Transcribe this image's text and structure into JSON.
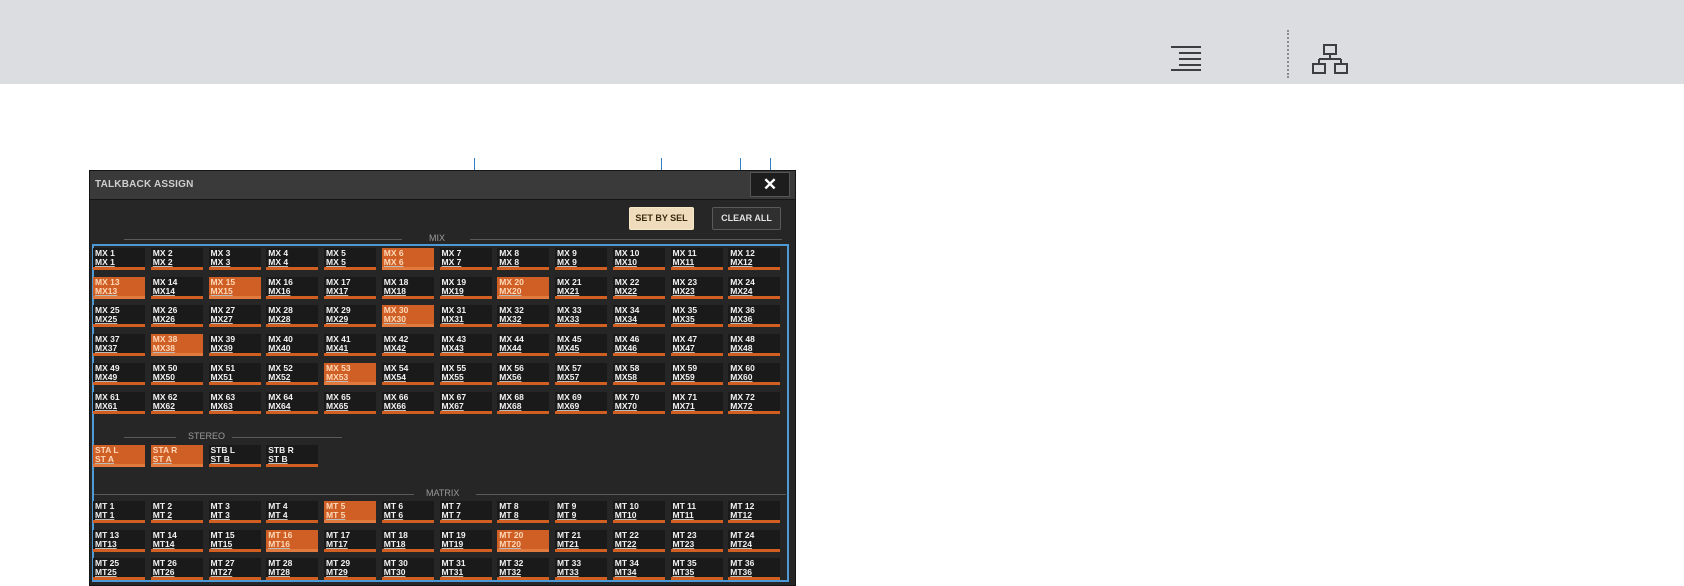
{
  "panel": {
    "title": "TALKBACK ASSIGN",
    "close_glyph": "✕",
    "buttons": {
      "set_by_sel": "SET BY SEL",
      "clear_all": "CLEAR ALL"
    }
  },
  "toolbar": {
    "icons": [
      "outline-menu-icon",
      "hierarchy-tree-icon"
    ]
  },
  "colors": {
    "active": "#cf5f25",
    "indicator": "#d25f22",
    "callout": "#2f7fc6",
    "panel": "#262626",
    "button_highlight": "#efdcbc"
  },
  "sections": {
    "mix": {
      "label": "MIX",
      "rows": [
        [
          {
            "a": "MX 1",
            "b": "MX 1",
            "on": false
          },
          {
            "a": "MX 2",
            "b": "MX 2",
            "on": false
          },
          {
            "a": "MX 3",
            "b": "MX 3",
            "on": false
          },
          {
            "a": "MX 4",
            "b": "MX 4",
            "on": false
          },
          {
            "a": "MX 5",
            "b": "MX 5",
            "on": false
          },
          {
            "a": "MX 6",
            "b": "MX 6",
            "on": true
          },
          {
            "a": "MX 7",
            "b": "MX 7",
            "on": false
          },
          {
            "a": "MX 8",
            "b": "MX 8",
            "on": false
          },
          {
            "a": "MX 9",
            "b": "MX 9",
            "on": false
          },
          {
            "a": "MX 10",
            "b": "MX10",
            "on": false
          },
          {
            "a": "MX 11",
            "b": "MX11",
            "on": false
          },
          {
            "a": "MX 12",
            "b": "MX12",
            "on": false
          }
        ],
        [
          {
            "a": "MX 13",
            "b": "MX13",
            "on": true
          },
          {
            "a": "MX 14",
            "b": "MX14",
            "on": false
          },
          {
            "a": "MX 15",
            "b": "MX15",
            "on": true
          },
          {
            "a": "MX 16",
            "b": "MX16",
            "on": false
          },
          {
            "a": "MX 17",
            "b": "MX17",
            "on": false
          },
          {
            "a": "MX 18",
            "b": "MX18",
            "on": false
          },
          {
            "a": "MX 19",
            "b": "MX19",
            "on": false
          },
          {
            "a": "MX 20",
            "b": "MX20",
            "on": true
          },
          {
            "a": "MX 21",
            "b": "MX21",
            "on": false
          },
          {
            "a": "MX 22",
            "b": "MX22",
            "on": false
          },
          {
            "a": "MX 23",
            "b": "MX23",
            "on": false
          },
          {
            "a": "MX 24",
            "b": "MX24",
            "on": false
          }
        ],
        [
          {
            "a": "MX 25",
            "b": "MX25",
            "on": false
          },
          {
            "a": "MX 26",
            "b": "MX26",
            "on": false
          },
          {
            "a": "MX 27",
            "b": "MX27",
            "on": false
          },
          {
            "a": "MX 28",
            "b": "MX28",
            "on": false
          },
          {
            "a": "MX 29",
            "b": "MX29",
            "on": false
          },
          {
            "a": "MX 30",
            "b": "MX30",
            "on": true
          },
          {
            "a": "MX 31",
            "b": "MX31",
            "on": false
          },
          {
            "a": "MX 32",
            "b": "MX32",
            "on": false
          },
          {
            "a": "MX 33",
            "b": "MX33",
            "on": false
          },
          {
            "a": "MX 34",
            "b": "MX34",
            "on": false
          },
          {
            "a": "MX 35",
            "b": "MX35",
            "on": false
          },
          {
            "a": "MX 36",
            "b": "MX36",
            "on": false
          }
        ],
        [
          {
            "a": "MX 37",
            "b": "MX37",
            "on": false
          },
          {
            "a": "MX 38",
            "b": "MX38",
            "on": true
          },
          {
            "a": "MX 39",
            "b": "MX39",
            "on": false
          },
          {
            "a": "MX 40",
            "b": "MX40",
            "on": false
          },
          {
            "a": "MX 41",
            "b": "MX41",
            "on": false
          },
          {
            "a": "MX 42",
            "b": "MX42",
            "on": false
          },
          {
            "a": "MX 43",
            "b": "MX43",
            "on": false
          },
          {
            "a": "MX 44",
            "b": "MX44",
            "on": false
          },
          {
            "a": "MX 45",
            "b": "MX45",
            "on": false
          },
          {
            "a": "MX 46",
            "b": "MX46",
            "on": false
          },
          {
            "a": "MX 47",
            "b": "MX47",
            "on": false
          },
          {
            "a": "MX 48",
            "b": "MX48",
            "on": false
          }
        ],
        [
          {
            "a": "MX 49",
            "b": "MX49",
            "on": false
          },
          {
            "a": "MX 50",
            "b": "MX50",
            "on": false
          },
          {
            "a": "MX 51",
            "b": "MX51",
            "on": false
          },
          {
            "a": "MX 52",
            "b": "MX52",
            "on": false
          },
          {
            "a": "MX 53",
            "b": "MX53",
            "on": true
          },
          {
            "a": "MX 54",
            "b": "MX54",
            "on": false
          },
          {
            "a": "MX 55",
            "b": "MX55",
            "on": false
          },
          {
            "a": "MX 56",
            "b": "MX56",
            "on": false
          },
          {
            "a": "MX 57",
            "b": "MX57",
            "on": false
          },
          {
            "a": "MX 58",
            "b": "MX58",
            "on": false
          },
          {
            "a": "MX 59",
            "b": "MX59",
            "on": false
          },
          {
            "a": "MX 60",
            "b": "MX60",
            "on": false
          }
        ],
        [
          {
            "a": "MX 61",
            "b": "MX61",
            "on": false
          },
          {
            "a": "MX 62",
            "b": "MX62",
            "on": false
          },
          {
            "a": "MX 63",
            "b": "MX63",
            "on": false
          },
          {
            "a": "MX 64",
            "b": "MX64",
            "on": false
          },
          {
            "a": "MX 65",
            "b": "MX65",
            "on": false
          },
          {
            "a": "MX 66",
            "b": "MX66",
            "on": false
          },
          {
            "a": "MX 67",
            "b": "MX67",
            "on": false
          },
          {
            "a": "MX 68",
            "b": "MX68",
            "on": false
          },
          {
            "a": "MX 69",
            "b": "MX69",
            "on": false
          },
          {
            "a": "MX 70",
            "b": "MX70",
            "on": false
          },
          {
            "a": "MX 71",
            "b": "MX71",
            "on": false
          },
          {
            "a": "MX 72",
            "b": "MX72",
            "on": false
          }
        ]
      ]
    },
    "stereo": {
      "label": "STEREO",
      "rows": [
        [
          {
            "a": "STA L",
            "b": "ST A",
            "on": true
          },
          {
            "a": "STA R",
            "b": "ST A",
            "on": true
          },
          {
            "a": "STB L",
            "b": "ST B",
            "on": false
          },
          {
            "a": "STB R",
            "b": "ST B",
            "on": false
          }
        ]
      ]
    },
    "matrix": {
      "label": "MATRIX",
      "rows": [
        [
          {
            "a": "MT 1",
            "b": "MT 1",
            "on": false
          },
          {
            "a": "MT 2",
            "b": "MT 2",
            "on": false
          },
          {
            "a": "MT 3",
            "b": "MT 3",
            "on": false
          },
          {
            "a": "MT 4",
            "b": "MT 4",
            "on": false
          },
          {
            "a": "MT 5",
            "b": "MT 5",
            "on": true
          },
          {
            "a": "MT 6",
            "b": "MT 6",
            "on": false
          },
          {
            "a": "MT 7",
            "b": "MT 7",
            "on": false
          },
          {
            "a": "MT 8",
            "b": "MT 8",
            "on": false
          },
          {
            "a": "MT 9",
            "b": "MT 9",
            "on": false
          },
          {
            "a": "MT 10",
            "b": "MT10",
            "on": false
          },
          {
            "a": "MT 11",
            "b": "MT11",
            "on": false
          },
          {
            "a": "MT 12",
            "b": "MT12",
            "on": false
          }
        ],
        [
          {
            "a": "MT 13",
            "b": "MT13",
            "on": false
          },
          {
            "a": "MT 14",
            "b": "MT14",
            "on": false
          },
          {
            "a": "MT 15",
            "b": "MT15",
            "on": false
          },
          {
            "a": "MT 16",
            "b": "MT16",
            "on": true
          },
          {
            "a": "MT 17",
            "b": "MT17",
            "on": false
          },
          {
            "a": "MT 18",
            "b": "MT18",
            "on": false
          },
          {
            "a": "MT 19",
            "b": "MT19",
            "on": false
          },
          {
            "a": "MT 20",
            "b": "MT20",
            "on": true
          },
          {
            "a": "MT 21",
            "b": "MT21",
            "on": false
          },
          {
            "a": "MT 22",
            "b": "MT22",
            "on": false
          },
          {
            "a": "MT 23",
            "b": "MT23",
            "on": false
          },
          {
            "a": "MT 24",
            "b": "MT24",
            "on": false
          }
        ],
        [
          {
            "a": "MT 25",
            "b": "MT25",
            "on": false
          },
          {
            "a": "MT 26",
            "b": "MT26",
            "on": false
          },
          {
            "a": "MT 27",
            "b": "MT27",
            "on": false
          },
          {
            "a": "MT 28",
            "b": "MT28",
            "on": false
          },
          {
            "a": "MT 29",
            "b": "MT29",
            "on": false
          },
          {
            "a": "MT 30",
            "b": "MT30",
            "on": false
          },
          {
            "a": "MT 31",
            "b": "MT31",
            "on": false
          },
          {
            "a": "MT 32",
            "b": "MT32",
            "on": false
          },
          {
            "a": "MT 33",
            "b": "MT33",
            "on": false
          },
          {
            "a": "MT 34",
            "b": "MT34",
            "on": false
          },
          {
            "a": "MT 35",
            "b": "MT35",
            "on": false
          },
          {
            "a": "MT 36",
            "b": "MT36",
            "on": false
          }
        ]
      ]
    }
  }
}
